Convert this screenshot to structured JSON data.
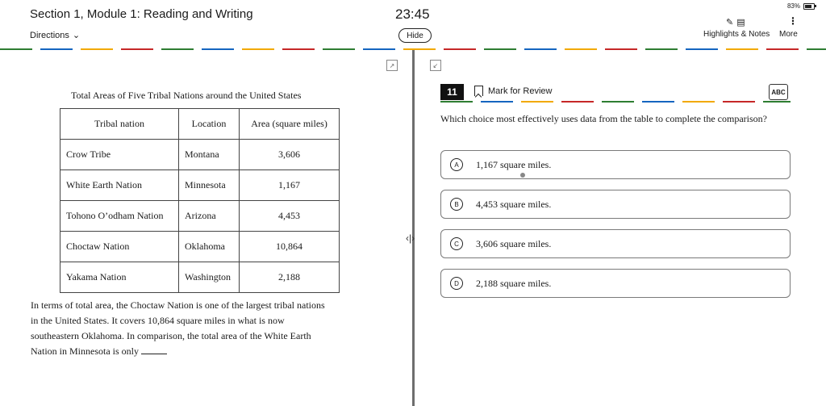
{
  "header": {
    "section_title": "Section 1, Module 1: Reading and Writing",
    "timer": "23:45",
    "directions_label": "Directions",
    "hide_label": "Hide",
    "battery_text": "83%",
    "battery_level": 0.83,
    "highlights_notes_label": "Highlights & Notes",
    "more_label": "More"
  },
  "table": {
    "title": "Total Areas of Five Tribal Nations around the United States",
    "headers": [
      "Tribal nation",
      "Location",
      "Area (square miles)"
    ],
    "rows": [
      [
        "Crow Tribe",
        "Montana",
        "3,606"
      ],
      [
        "White Earth Nation",
        "Minnesota",
        "1,167"
      ],
      [
        "Tohono O’odham Nation",
        "Arizona",
        "4,453"
      ],
      [
        "Choctaw Nation",
        "Oklahoma",
        "10,864"
      ],
      [
        "Yakama Nation",
        "Washington",
        "2,188"
      ]
    ]
  },
  "passage": {
    "line1": "In terms of total area, the Choctaw Nation is one of the largest tribal nations",
    "line2": "in the United States. It covers 10,864 square miles in what is now",
    "line3": "southeastern Oklahoma. In comparison, the total area of the White Earth",
    "line4": "Nation in Minnesota is only"
  },
  "question": {
    "number": "11",
    "mark_review_label": "Mark for Review",
    "abc_label": "ABC",
    "prompt": "Which choice most effectively uses data from the table to complete the comparison?",
    "choices": [
      {
        "letter": "A",
        "text": "1,167 square miles."
      },
      {
        "letter": "B",
        "text": "4,453 square miles."
      },
      {
        "letter": "C",
        "text": "3,606 square miles."
      },
      {
        "letter": "D",
        "text": "2,188 square miles."
      }
    ]
  },
  "colors": {
    "rule_green": "#2e7d32",
    "rule_blue": "#1565c0",
    "rule_yellow": "#f2a900",
    "rule_red": "#c62828",
    "divider": "#6e6e6e"
  }
}
